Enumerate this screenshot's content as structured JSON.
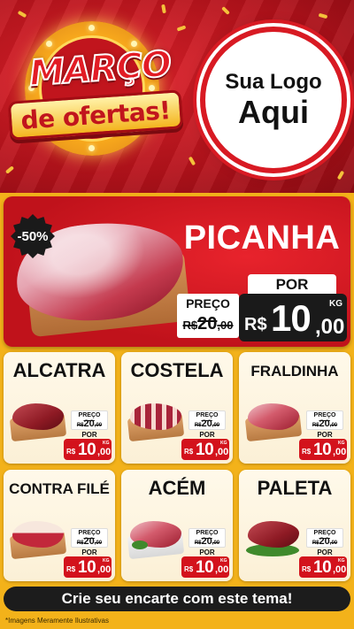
{
  "header": {
    "campaign_line1": "MARÇO",
    "campaign_line2": "de ofertas!",
    "logo_line1": "Sua Logo",
    "logo_line2": "Aqui"
  },
  "highlight": {
    "discount": "-50%",
    "name": "PICANHA",
    "old_label": "PREÇO",
    "old_currency": "R$",
    "old_int": "20",
    "old_dec": ",00",
    "por_label": "POR",
    "currency": "R$",
    "price_int": "10",
    "price_dec": ",00",
    "unit": "KG"
  },
  "products": [
    {
      "name": "ALCATRA",
      "old_label": "PREÇO",
      "old_currency": "R$",
      "old_int": "20",
      "old_dec": ",00",
      "por_label": "POR",
      "currency": "R$",
      "price_int": "10",
      "price_dec": ",00",
      "unit": "KG"
    },
    {
      "name": "COSTELA",
      "old_label": "PREÇO",
      "old_currency": "R$",
      "old_int": "20",
      "old_dec": ",00",
      "por_label": "POR",
      "currency": "R$",
      "price_int": "10",
      "price_dec": ",00",
      "unit": "KG"
    },
    {
      "name": "FRALDINHA",
      "old_label": "PREÇO",
      "old_currency": "R$",
      "old_int": "20",
      "old_dec": ",00",
      "por_label": "POR",
      "currency": "R$",
      "price_int": "10",
      "price_dec": ",00",
      "unit": "KG"
    },
    {
      "name": "CONTRA FILÉ",
      "old_label": "PREÇO",
      "old_currency": "R$",
      "old_int": "20",
      "old_dec": ",00",
      "por_label": "POR",
      "currency": "R$",
      "price_int": "10",
      "price_dec": ",00",
      "unit": "KG"
    },
    {
      "name": "ACÉM",
      "old_label": "PREÇO",
      "old_currency": "R$",
      "old_int": "20",
      "old_dec": ",00",
      "por_label": "POR",
      "currency": "R$",
      "price_int": "10",
      "price_dec": ",00",
      "unit": "KG"
    },
    {
      "name": "PALETA",
      "old_label": "PREÇO",
      "old_currency": "R$",
      "old_int": "20",
      "old_dec": ",00",
      "por_label": "POR",
      "currency": "R$",
      "price_int": "10",
      "price_dec": ",00",
      "unit": "KG"
    }
  ],
  "cta": {
    "label": "Crie seu encarte com este tema!"
  },
  "footer": {
    "disclaimer": "*Imagens Meramente Ilustrativas"
  },
  "colors": {
    "primary_red": "#d3121c",
    "accent_yellow": "#f3b21a",
    "dark": "#1a1a1a"
  }
}
